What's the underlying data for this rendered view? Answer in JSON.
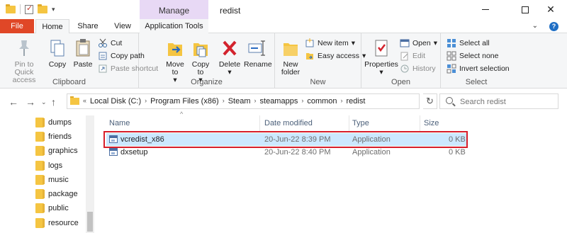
{
  "window": {
    "title": "redist",
    "context_group": "Manage"
  },
  "ribbon_tabs": [
    "File",
    "Home",
    "Share",
    "View",
    "Application Tools"
  ],
  "clipboard": {
    "pin_label": "Pin to Quick access",
    "copy_label": "Copy",
    "paste_label": "Paste",
    "cut_label": "Cut",
    "copy_path_label": "Copy path",
    "paste_shortcut_label": "Paste shortcut",
    "group_label": "Clipboard"
  },
  "organize": {
    "move_to_label": "Move to",
    "copy_to_label": "Copy to",
    "delete_label": "Delete",
    "rename_label": "Rename",
    "group_label": "Organize"
  },
  "new_group": {
    "new_folder_label": "New folder",
    "new_item_label": "New item",
    "easy_access_label": "Easy access",
    "group_label": "New"
  },
  "open_group": {
    "properties_label": "Properties",
    "open_label": "Open",
    "edit_label": "Edit",
    "history_label": "History",
    "group_label": "Open"
  },
  "select_group": {
    "select_all_label": "Select all",
    "select_none_label": "Select none",
    "invert_label": "Invert selection",
    "group_label": "Select"
  },
  "address": {
    "crumbs": [
      "Local Disk (C:)",
      "Program Files (x86)",
      "Steam",
      "steamapps",
      "common",
      "redist"
    ],
    "search_placeholder": "Search redist"
  },
  "nav_folders": [
    "dumps",
    "friends",
    "graphics",
    "logs",
    "music",
    "package",
    "public",
    "resource"
  ],
  "columns": [
    "Name",
    "Date modified",
    "Type",
    "Size"
  ],
  "files": [
    {
      "name": "vcredist_x86",
      "date": "20-Jun-22 8:39 PM",
      "type": "Application",
      "size": "0 KB"
    },
    {
      "name": "dxsetup",
      "date": "20-Jun-22 8:40 PM",
      "type": "Application",
      "size": "0 KB"
    }
  ],
  "colors": {
    "file_tab": "#e04727",
    "manage_band": "#e8d9f5",
    "selection": "#cce8ff",
    "highlight_border": "#d71f2b"
  }
}
